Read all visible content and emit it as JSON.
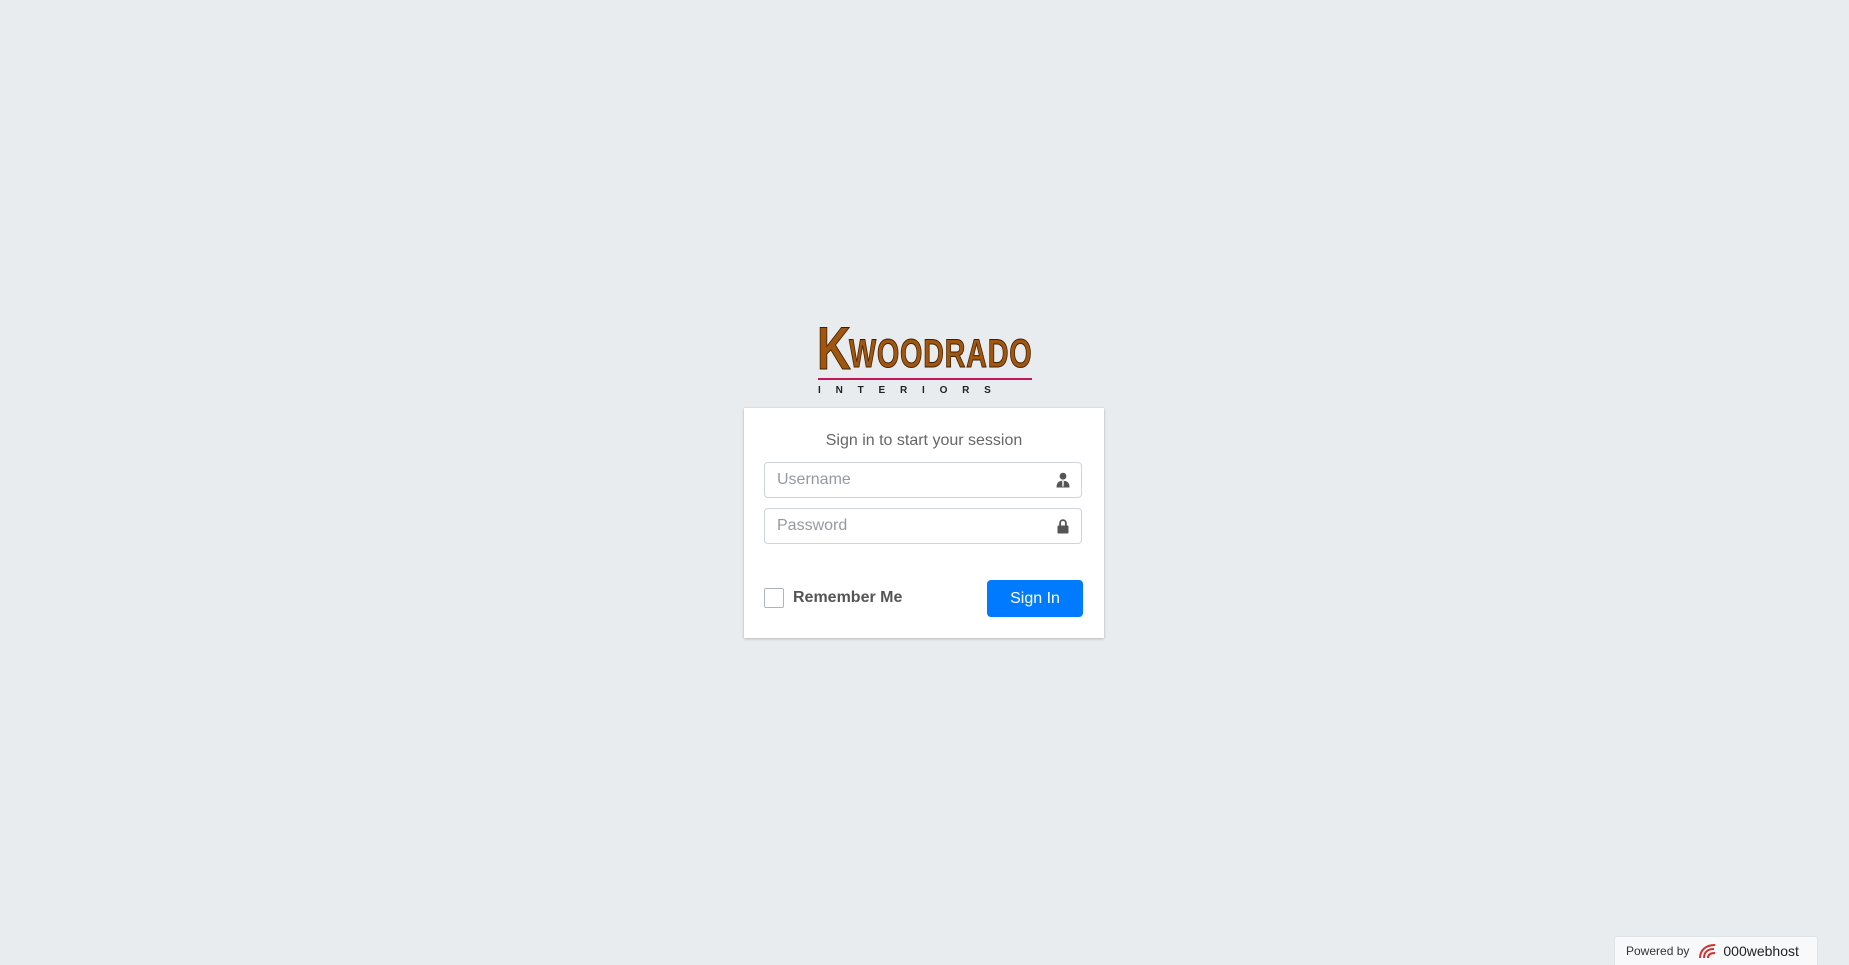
{
  "logo": {
    "initial": "K",
    "name": "WOODRADO",
    "tagline": "INTERIORS",
    "color": "#a0560e",
    "rule_color": "#c2185b"
  },
  "login": {
    "message": "Sign in to start your session",
    "username_placeholder": "Username",
    "password_placeholder": "Password",
    "remember_label": "Remember Me",
    "remember_checked": false,
    "submit_label": "Sign In",
    "button_color": "#007bff"
  },
  "footer": {
    "powered_label": "Powered by",
    "brand": "000webhost"
  }
}
